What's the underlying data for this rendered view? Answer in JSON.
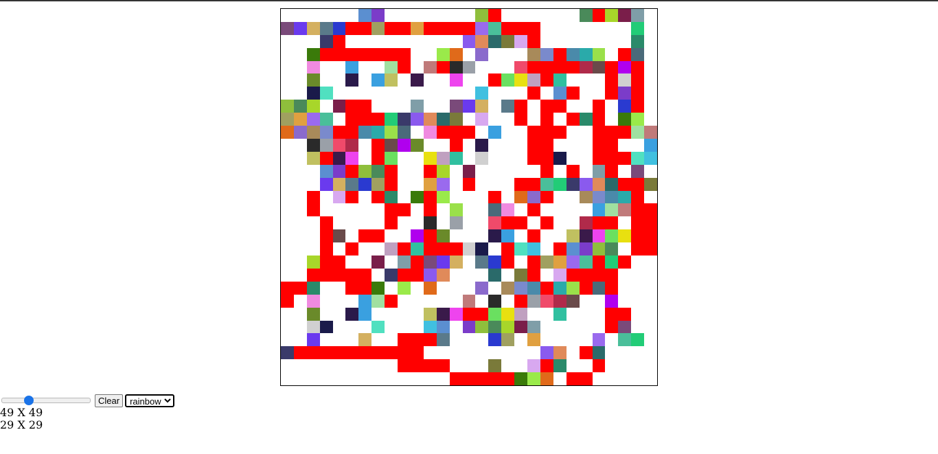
{
  "grid": {
    "rows": 29,
    "cols": 29,
    "cells": [
      "......CC.......C#......C#CCC.",
      "CCCCC##C##C####CC###.......C.",
      "...C#.........CCCCC#.......C.",
      "..C#######..CC.C...CC#CCC.#C.",
      "..C..C..C#.C#CC...C####CC#C#.",
      "..C..C.CC.C..C..#CCC#C...#C#.",
      "..CC...........C...#.C#..#C#.",
      "CCC.C##...C..CCC.C#.##..#.C#.",
      "CCCC.###CCCCCC.C..#.#.#C#.CC.",
      "CCCC##CCCC.C###.C..###..###CC",
      "..CCCC.#CCC..#.C...##...##..C",
      "..C#CC.#C..CCC.C...##C..###CC",
      "...CC#CC#..#C.C.....#.#.C#.C.",
      "...CCCCC#..CC.#...##CCCCCC##C",
      "..#.C#.#C.C#C...#.CC#..CCCC#.",
      "..#.....##.#.C..CC.#....CCC##",
      "...#....#..C.C..C##.#..C##.##",
      "...#C.##..C#C...CC.#..CCCCC##",
      "...#.#..C#C###CC.#CC.#CCCC.##",
      "..C##..C.C#CCC.CC#.#CCCC#C#..",
      "..#####.C##CC...C.C#.C####...",
      "##C..##C.C.C...C.CCC#CC#C#...",
      "#.C...CC#.....C.C.#CCCC..C...",
      "..C..CC....CCC##CCC..C...##..",
      "..CC...C...CC.CCCCCC.....#C.",
      "..C...C..###C...CC.C....C.CC.",
      "C##########.........CC.#C....",
      ".........####...C..C#C..#....",
      ".............#####CCC.##....."
    ],
    "legend": {
      "#": "#ff0000",
      "C": "#7b5cc9"
    }
  },
  "controls": {
    "slider_value": "29",
    "clear_label": "Clear",
    "mode_selected": "rainbow",
    "mode_options": [
      "rainbow"
    ]
  },
  "info": {
    "max_size": "49 X 49",
    "current_size": "29 X 29"
  }
}
